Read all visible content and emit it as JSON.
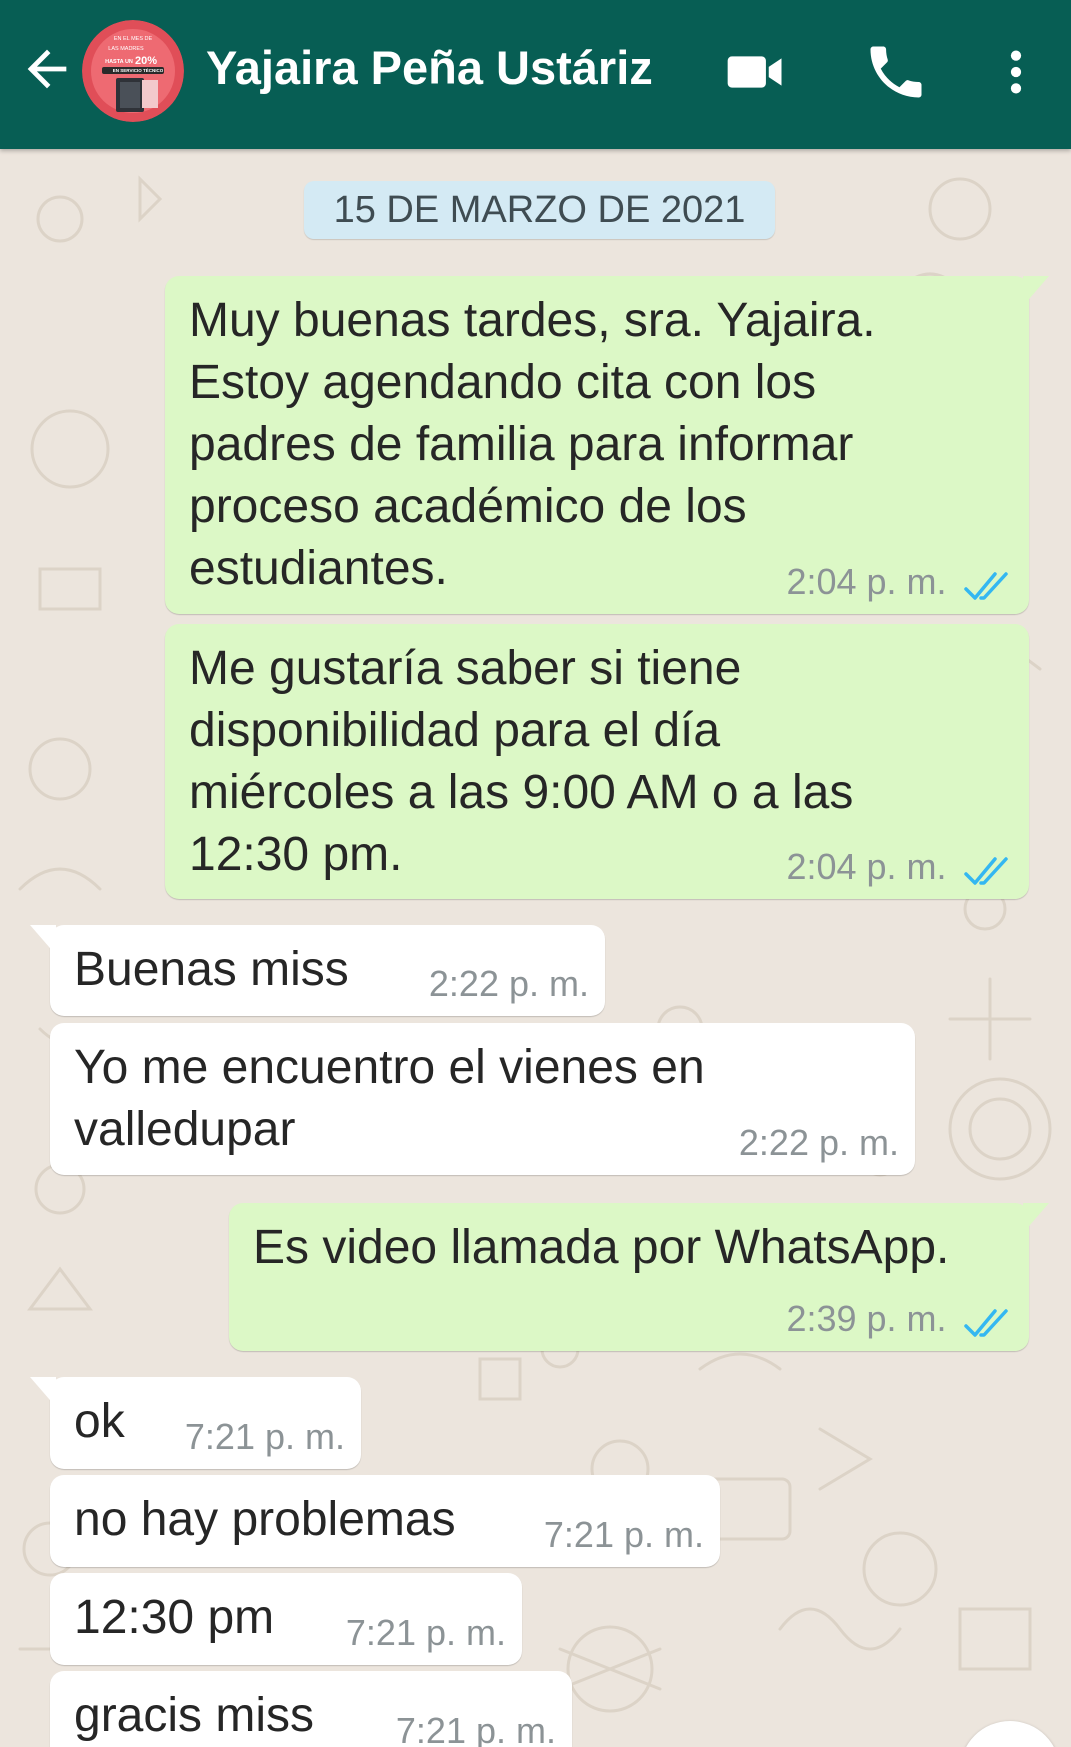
{
  "header": {
    "contact_name": "Yajaira Peña Ustáriz",
    "avatar_text": [
      "EN EL MES DE",
      "LAS MADRES",
      "HASTA UN",
      "20%",
      "EN SERVICIO TÉCNICO"
    ],
    "colors": {
      "bar": "#075e54",
      "text": "#ffffff"
    },
    "icons": [
      "back-arrow-icon",
      "video-call-icon",
      "phone-icon",
      "more-options-icon"
    ]
  },
  "chat": {
    "date_label": "15 DE MARZO DE 2021",
    "colors": {
      "outgoing": "#dcf8c6",
      "incoming": "#ffffff",
      "read_ticks": "#34b7f1",
      "wallpaper": "#ece5dd"
    },
    "messages": [
      {
        "direction": "out",
        "lines": [
          "Muy buenas tardes, sra. Yajaira.",
          "Estoy agendando cita con los",
          "padres de familia para informar",
          "proceso académico de los",
          "estudiantes."
        ],
        "time": "2:04 p. m.",
        "status": "read"
      },
      {
        "direction": "out",
        "lines": [
          "Me gustaría saber si tiene",
          "disponibilidad para el día",
          "miércoles a las 9:00 AM o a las",
          "12:30 pm."
        ],
        "time": "2:04 p. m.",
        "status": "read"
      },
      {
        "direction": "in",
        "lines": [
          "Buenas miss"
        ],
        "time": "2:22 p. m."
      },
      {
        "direction": "in",
        "lines": [
          "Yo me encuentro el vienes en",
          "valledupar"
        ],
        "time": "2:22 p. m."
      },
      {
        "direction": "out",
        "lines": [
          "Es video llamada por WhatsApp."
        ],
        "time": "2:39 p. m.",
        "status": "read"
      },
      {
        "direction": "in",
        "lines": [
          "ok"
        ],
        "time": "7:21 p. m."
      },
      {
        "direction": "in",
        "lines": [
          "no hay problemas"
        ],
        "time": "7:21 p. m."
      },
      {
        "direction": "in",
        "lines": [
          "12:30 pm"
        ],
        "time": "7:21 p. m."
      },
      {
        "direction": "in",
        "lines": [
          "gracis miss"
        ],
        "time": "7:21 p. m."
      }
    ]
  }
}
